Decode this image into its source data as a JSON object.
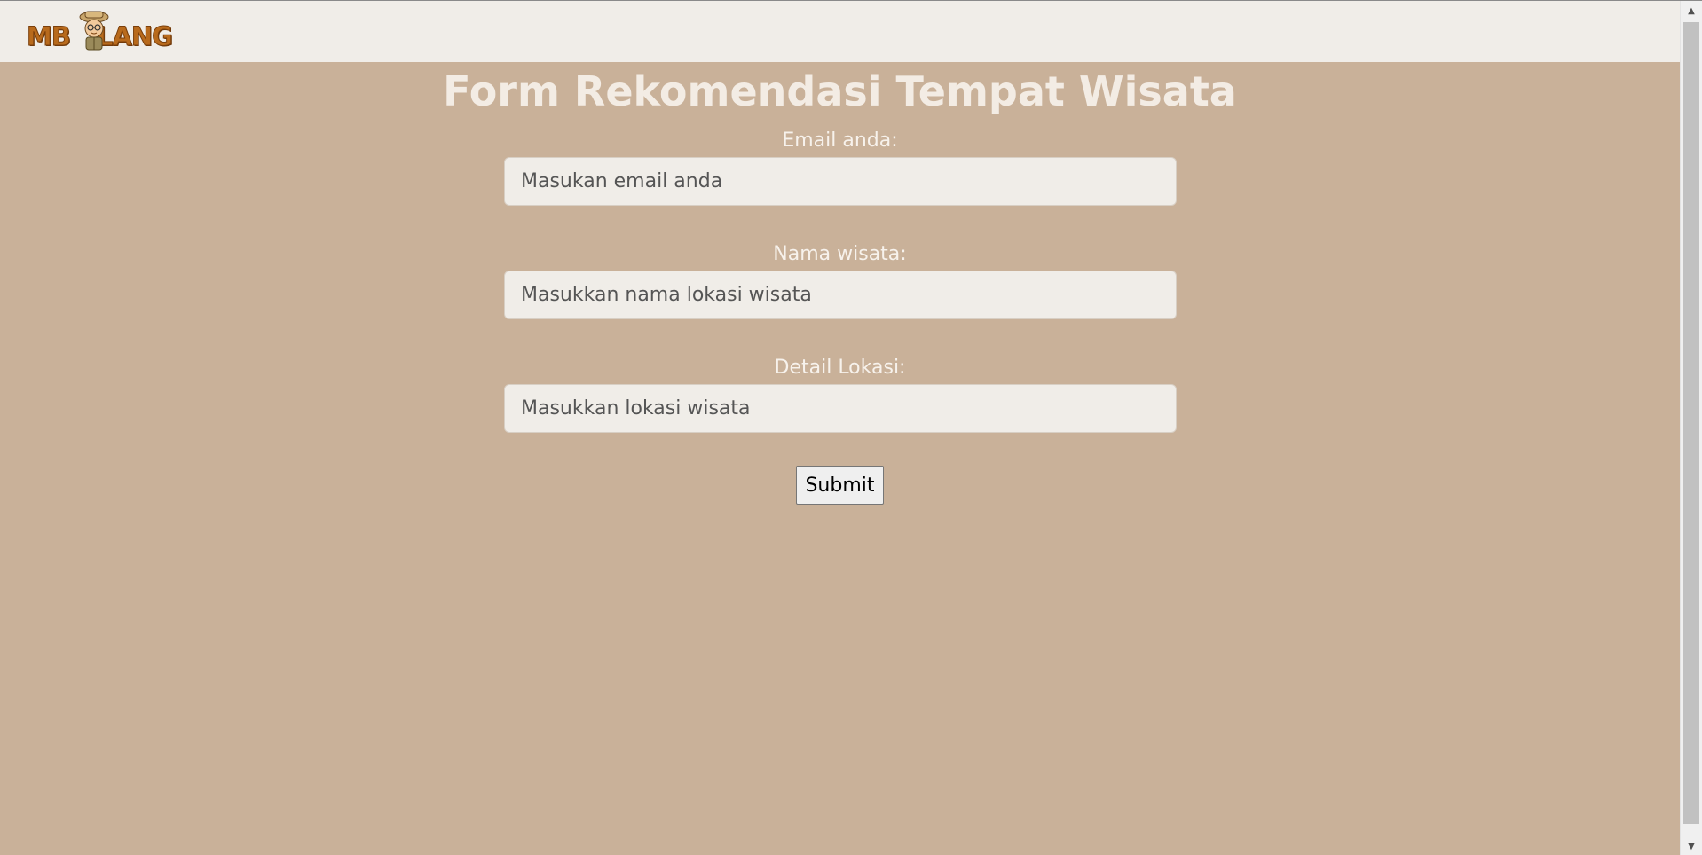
{
  "brand": {
    "logo_text_left": "MB",
    "logo_text_right": "LANG",
    "logo_icon": "explorer-mascot-icon"
  },
  "form": {
    "title": "Form Rekomendasi Tempat Wisata",
    "email": {
      "label": "Email anda:",
      "placeholder": "Masukan email anda",
      "value": ""
    },
    "nama_wisata": {
      "label": "Nama wisata:",
      "placeholder": "Masukkan nama lokasi wisata",
      "value": ""
    },
    "detail_lokasi": {
      "label": "Detail Lokasi:",
      "placeholder": "Masukkan lokasi wisata",
      "value": ""
    },
    "submit_label": "Submit"
  },
  "scrollbar": {
    "up_icon": "scroll-up-arrow-icon",
    "down_icon": "scroll-down-arrow-icon"
  },
  "colors": {
    "background": "#c9b199",
    "navbar": "#f0ede8",
    "title": "#f3ece4",
    "label": "#f7f2ec",
    "field_bg": "#f0ede8",
    "logo": "#b86a1c"
  }
}
